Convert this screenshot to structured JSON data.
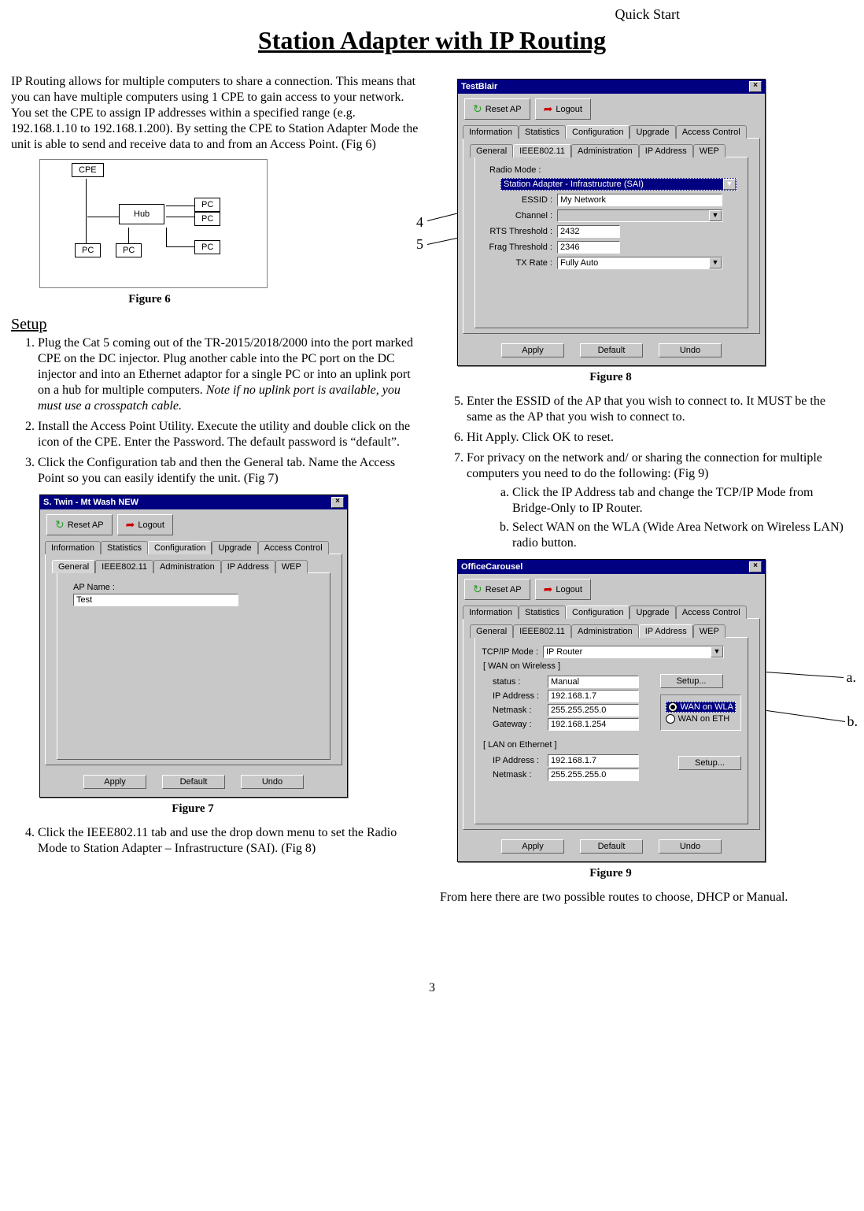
{
  "header": {
    "right": "Quick Start",
    "title": "Station Adapter with IP Routing"
  },
  "intro": "IP Routing allows for multiple computers to share a connection. This means that you can have multiple computers using 1 CPE to gain access to your network. You set the CPE to assign IP addresses within a specified range (e.g. 192.168.1.10 to 192.168.1.200). By setting the CPE to Station Adapter Mode the unit is able to send and receive data to and from an Access Point. (Fig 6)",
  "fig6": {
    "caption": "Figure 6",
    "boxes": {
      "cpe": "CPE",
      "hub": "Hub",
      "pc": "PC"
    }
  },
  "setup_heading": "Setup",
  "steps_left": {
    "1": {
      "main": "Plug the Cat 5 coming out of the TR-2015/2018/2000 into the port marked CPE on the DC injector. Plug another cable into the PC port on the DC injector and into an Ethernet adaptor for a single PC or into an uplink port on a hub for multiple computers. ",
      "note": "Note if no uplink port is available, you must use a crosspatch cable."
    },
    "2": "Install the Access Point Utility. Execute the utility and double click on the icon of the CPE. Enter the Password. The default password is “default”.",
    "3": "Click the Configuration tab and then the General tab. Name the Access Point so you can easily identify the unit. (Fig 7)",
    "4": "Click the IEEE802.11 tab and use the drop down menu to set the Radio Mode to Station Adapter – Infrastructure (SAI). (Fig 8)"
  },
  "fig7": {
    "caption": "Figure 7",
    "title": "S. Twin - Mt Wash NEW",
    "reset": "Reset AP",
    "logout": "Logout",
    "tabs1": [
      "Information",
      "Statistics",
      "Configuration",
      "Upgrade",
      "Access Control"
    ],
    "tabs2": [
      "General",
      "IEEE802.11",
      "Administration",
      "IP Address",
      "WEP"
    ],
    "apname_label": "AP Name :",
    "apname_value": "Test",
    "buttons": {
      "apply": "Apply",
      "default": "Default",
      "undo": "Undo"
    }
  },
  "callouts_fig8": {
    "c4": "4",
    "c5": "5"
  },
  "fig8": {
    "caption": "Figure 8",
    "title": "TestBlair",
    "reset": "Reset AP",
    "logout": "Logout",
    "tabs1": [
      "Information",
      "Statistics",
      "Configuration",
      "Upgrade",
      "Access Control"
    ],
    "tabs2": [
      "General",
      "IEEE802.11",
      "Administration",
      "IP Address",
      "WEP"
    ],
    "radiomode_label": "Radio Mode :",
    "radiomode_value": "Station Adapter - Infrastructure (SAI)",
    "essid_label": "ESSID :",
    "essid_value": "My Network",
    "channel_label": "Channel :",
    "channel_value": "",
    "rts_label": "RTS Threshold :",
    "rts_value": "2432",
    "frag_label": "Frag Threshold :",
    "frag_value": "2346",
    "tx_label": "TX Rate :",
    "tx_value": "Fully Auto",
    "buttons": {
      "apply": "Apply",
      "default": "Default",
      "undo": "Undo"
    }
  },
  "steps_right": {
    "5": "Enter the ESSID of the AP that you wish to connect to. It MUST be the same as the AP that you wish to connect to.",
    "6": "Hit Apply. Click OK to reset.",
    "7": "For privacy on the network and/ or sharing the connection for multiple computers you need to do the following: (Fig 9)",
    "7a": "Click the IP Address tab and change the TCP/IP Mode from Bridge-Only to IP Router.",
    "7b": "Select WAN on the WLA (Wide Area Network on Wireless LAN) radio button."
  },
  "callouts_fig9": {
    "a": "a.",
    "b": "b."
  },
  "fig9": {
    "caption": "Figure 9",
    "title": "OfficeCarousel",
    "reset": "Reset AP",
    "logout": "Logout",
    "tabs1": [
      "Information",
      "Statistics",
      "Configuration",
      "Upgrade",
      "Access Control"
    ],
    "tabs2": [
      "General",
      "IEEE802.11",
      "Administration",
      "IP Address",
      "WEP"
    ],
    "tcpip_label": "TCP/IP Mode :",
    "tcpip_value": "IP Router",
    "wan_heading": "[ WAN on Wireless ]",
    "status_label": "status :",
    "status_value": "Manual",
    "ip_label": "IP Address :",
    "ip_value": "192.168.1.7",
    "mask_label": "Netmask :",
    "mask_value": "255.255.255.0",
    "gw_label": "Gateway :",
    "gw_value": "192.168.1.254",
    "setup_btn": "Setup...",
    "radio_wla": "WAN on WLA",
    "radio_eth": "WAN on ETH",
    "lan_heading": "[ LAN on Ethernet ]",
    "lan_ip_label": "IP Address :",
    "lan_ip_value": "192.168.1.7",
    "lan_mask_label": "Netmask :",
    "lan_mask_value": "255.255.255.0",
    "buttons": {
      "apply": "Apply",
      "default": "Default",
      "undo": "Undo"
    }
  },
  "closing": "From here there are two possible routes to choose, DHCP or Manual.",
  "page_number": "3"
}
